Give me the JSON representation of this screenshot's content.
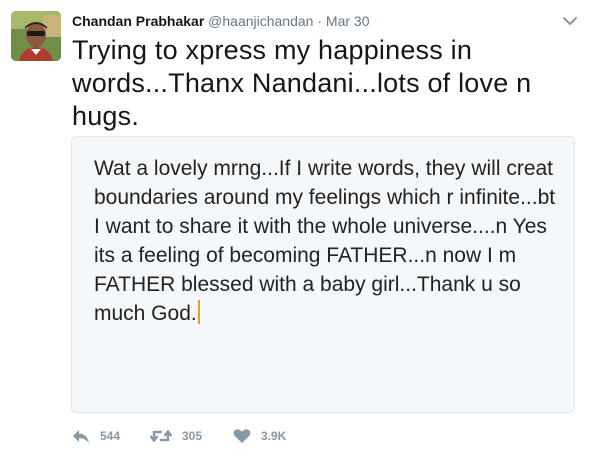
{
  "tweet": {
    "author_name": "Chandan Prabhakar",
    "author_handle": "@haanjichandan",
    "separator": "·",
    "timestamp": "Mar 30",
    "text": "Trying to xpress my happiness in words...Thanx Nandani...lots of love n hugs.",
    "media_text": "Wat a lovely mrng...If I write words, they will creat boundaries around my feelings which r infinite...bt I want to share it with the whole universe....n Yes its a feeling of becoming FATHER...n now I m FATHER blessed with a baby girl...Thank u so much God.",
    "actions": {
      "reply_count": "544",
      "retweet_count": "305",
      "like_count": "3.9K"
    }
  },
  "icons": {
    "avatar": "profile-photo",
    "caret": "chevron-down-icon",
    "reply": "reply-icon",
    "retweet": "retweet-icon",
    "like": "heart-icon"
  },
  "colors": {
    "text_primary": "#14171a",
    "text_secondary": "#657786",
    "icon_gray": "#8899a6",
    "card_background": "#f5f8fa",
    "card_border": "#e1e8ed",
    "cursor": "#e8a21d"
  }
}
